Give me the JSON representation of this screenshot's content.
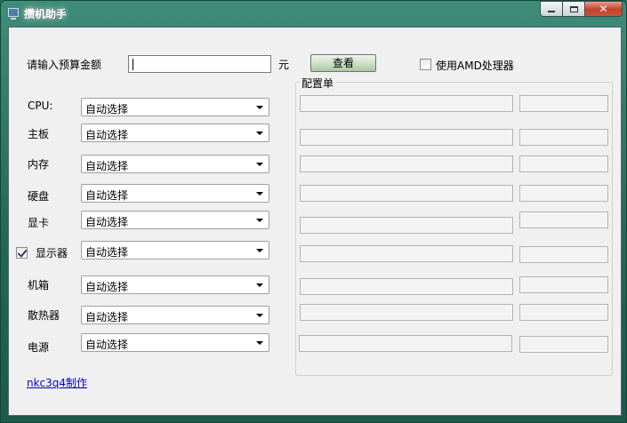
{
  "window": {
    "title": "攒机助手"
  },
  "budget": {
    "label": "请输入预算金额",
    "value": "",
    "unit": "元"
  },
  "view_button": "查看",
  "amd": {
    "label": "使用AMD处理器",
    "checked": false
  },
  "components": [
    {
      "label": "CPU:",
      "value": "自动选择"
    },
    {
      "label": "主板",
      "value": "自动选择"
    },
    {
      "label": "内存",
      "value": "自动选择"
    },
    {
      "label": "硬盘",
      "value": "自动选择"
    },
    {
      "label": "显卡",
      "value": "自动选择"
    },
    {
      "label": "显示器",
      "value": "自动选择",
      "checked": true
    },
    {
      "label": "机箱",
      "value": "自动选择"
    },
    {
      "label": "散热器",
      "value": "自动选择"
    },
    {
      "label": "电源",
      "value": "自动选择"
    }
  ],
  "config_group": {
    "title": "配置单"
  },
  "footer_link": "nkc3q4制作"
}
